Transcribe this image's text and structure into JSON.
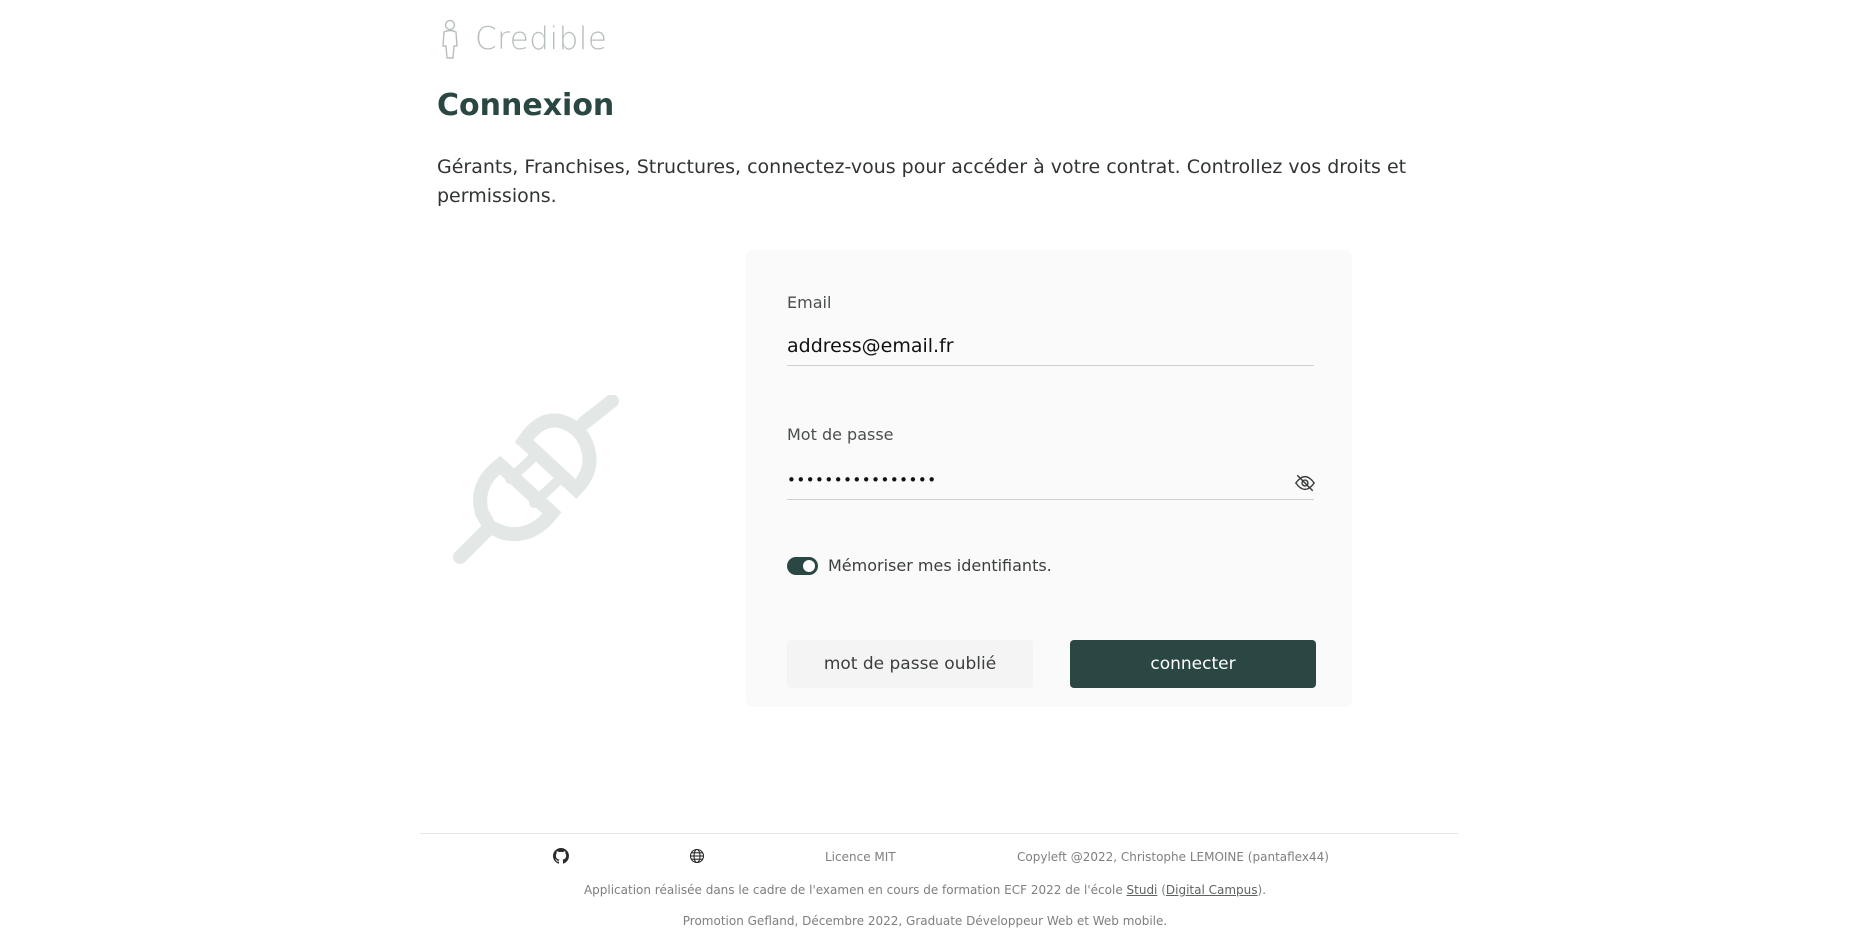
{
  "brand": {
    "name": "Credible",
    "icon": "person-icon"
  },
  "page": {
    "title": "Connexion",
    "intro": "Gérants, Franchises, Structures, connectez-vous pour accéder à votre contrat. Controllez vos droits et permissions."
  },
  "illustration": {
    "icon": "plug-icon"
  },
  "login_form": {
    "email_label": "Email",
    "email_value": "address@email.fr",
    "password_label": "Mot de passe",
    "password_value": "••••••••••••••••",
    "password_toggle_icon": "eye-slash-icon",
    "remember_label": "Mémoriser mes identifiants.",
    "remember_checked": true,
    "forgot_button": "mot de passe oublié",
    "connect_button": "connecter"
  },
  "footer": {
    "github_icon": "github-icon",
    "globe_icon": "globe-icon",
    "licence": "Licence MIT",
    "copyleft": "Copyleft @2022, Christophe LEMOINE (pantaflex44)",
    "line1_prefix": "Application réalisée dans le cadre de l'examen en cours de formation ECF 2022 de l'école ",
    "line1_studi": "Studi",
    "line1_middle": " (",
    "line1_digital": "Digital Campus",
    "line1_suffix": ").",
    "line2": "Promotion Gefland, Décembre 2022, Graduate Développeur Web et Web mobile."
  },
  "colors": {
    "primary": "#2b4743",
    "card_background": "#fafafa",
    "brand_text": "#b7bfbd",
    "illustration": "#e3e8e6"
  }
}
